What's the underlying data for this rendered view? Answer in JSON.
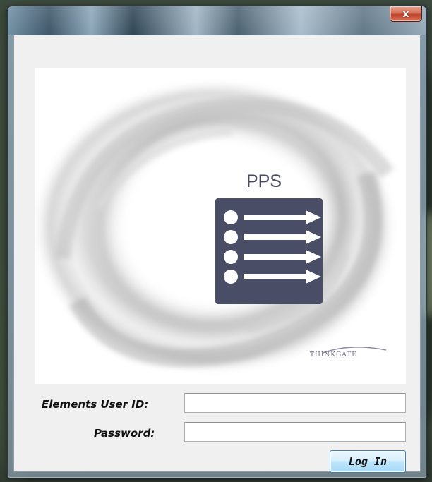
{
  "window": {
    "close_label": "x"
  },
  "splash": {
    "app_name": "PPS",
    "vendor_logo_text": "THINKGATE",
    "app_icon": "list-arrows-icon"
  },
  "form": {
    "user_id_label": "Elements User ID:",
    "user_id_value": "",
    "password_label": "Password:",
    "password_value": "",
    "login_label": "Log In"
  },
  "colors": {
    "icon_fill": "#4a4d66",
    "button_border": "#3c7fb1",
    "close_button": "#c0432b"
  }
}
